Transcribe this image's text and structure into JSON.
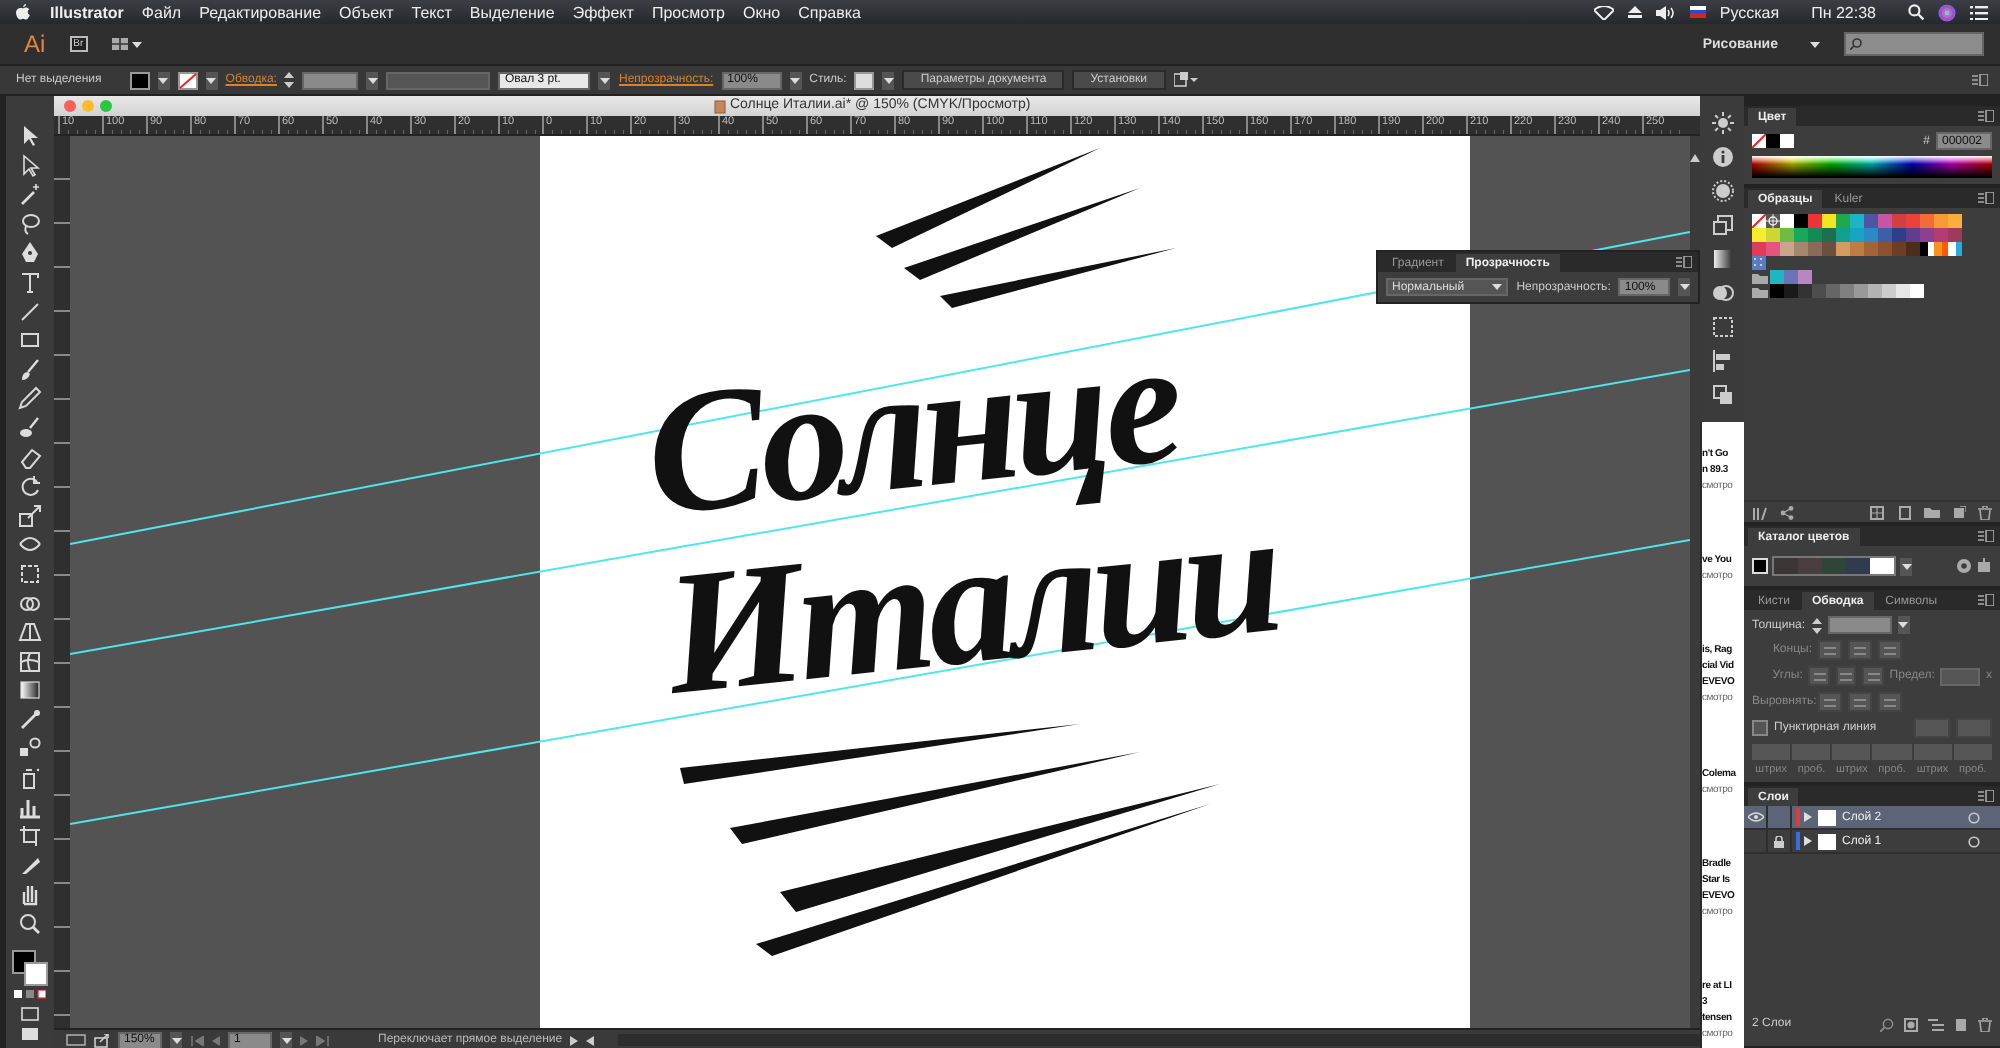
{
  "menu_bar": {
    "app": "Illustrator",
    "items": [
      "Файл",
      "Редактирование",
      "Объект",
      "Текст",
      "Выделение",
      "Эффект",
      "Просмотр",
      "Окно",
      "Справка"
    ],
    "input_source": "Русская",
    "clock": "Пн 22:38"
  },
  "app_bar": {
    "logo": "Ai",
    "bridge": "Br",
    "workspace": "Рисование"
  },
  "control_bar": {
    "selection": "Нет выделения",
    "stroke_label": "Обводка:",
    "brush": "Овал 3 pt.",
    "opacity_label": "Непрозрачность:",
    "opacity": "100%",
    "style_label": "Стиль:",
    "buttons": [
      "Параметры документа",
      "Установки"
    ]
  },
  "document": {
    "title": "Солнце Италии.ai* @ 150% (CMYK/Просмотр)",
    "ruler": [
      "10",
      "100",
      "90",
      "80",
      "70",
      "60",
      "50",
      "40",
      "30",
      "20",
      "10",
      "0",
      "10",
      "20",
      "30",
      "40",
      "50",
      "60",
      "70",
      "80",
      "90",
      "100",
      "110",
      "120",
      "130",
      "140",
      "150",
      "160",
      "170",
      "180",
      "190",
      "200",
      "210",
      "220",
      "230",
      "240",
      "250"
    ],
    "lettering": [
      "Солнце",
      "Италии"
    ]
  },
  "transparency_panel": {
    "tabs": [
      {
        "label": "Градиент",
        "selected": false
      },
      {
        "label": "Прозрачность",
        "selected": true
      }
    ],
    "blend_mode": "Нормальный",
    "opacity_label": "Непрозрачность:",
    "opacity": "100%"
  },
  "status_bar": {
    "zoom": "150%",
    "artboard": "1",
    "message": "Переключает прямое выделение"
  },
  "background_window": {
    "blocks": [
      [
        "n't Go",
        "n 89.3",
        "смотро"
      ],
      [
        "ve You",
        "смотро"
      ],
      [
        "is, Rag",
        "cial Vid",
        "EVEVO",
        "смотро"
      ],
      [
        "Colema",
        "смотро"
      ],
      [
        "Bradle",
        "Star Is",
        "EVEVO",
        "смотро"
      ],
      [
        "re at LI",
        "3",
        "tensen",
        "смотро"
      ]
    ]
  },
  "color_panel": {
    "title": "Цвет",
    "hex_label": "#",
    "hex": "000002"
  },
  "swatches_panel": {
    "tabs": [
      {
        "label": "Образцы",
        "selected": true
      },
      {
        "label": "Kuler",
        "selected": false
      }
    ],
    "rows": [
      {
        "folder": false,
        "swatches": [
          {
            "kind": "none"
          },
          {
            "kind": "registration"
          },
          {
            "kind": "color",
            "color": "#ffffff"
          },
          {
            "kind": "color",
            "color": "#000000"
          },
          {
            "kind": "color",
            "color": "#ee3338"
          },
          {
            "kind": "color",
            "color": "#f4e426"
          },
          {
            "kind": "color",
            "color": "#1fa84f"
          },
          {
            "kind": "color",
            "color": "#1cb5c8"
          },
          {
            "kind": "color",
            "color": "#4e55a5"
          },
          {
            "kind": "color",
            "color": "#c855a3"
          },
          {
            "kind": "color",
            "color": "#d33f3f"
          },
          {
            "kind": "color",
            "color": "#e8433b"
          },
          {
            "kind": "color",
            "color": "#f26b3a"
          },
          {
            "kind": "color",
            "color": "#f79a33"
          },
          {
            "kind": "color",
            "color": "#fbad3e"
          }
        ]
      },
      {
        "folder": false,
        "swatches": [
          {
            "kind": "color",
            "color": "#f7ec2d"
          },
          {
            "kind": "color",
            "color": "#cdd733"
          },
          {
            "kind": "color",
            "color": "#6dbd45"
          },
          {
            "kind": "color",
            "color": "#18a85a"
          },
          {
            "kind": "color",
            "color": "#138b54"
          },
          {
            "kind": "color",
            "color": "#1d6e53"
          },
          {
            "kind": "color",
            "color": "#139f8e"
          },
          {
            "kind": "color",
            "color": "#17a4c1"
          },
          {
            "kind": "color",
            "color": "#2b8ac5"
          },
          {
            "kind": "color",
            "color": "#3d5ea9"
          },
          {
            "kind": "color",
            "color": "#2d3e8a"
          },
          {
            "kind": "color",
            "color": "#613d8f"
          },
          {
            "kind": "color",
            "color": "#8d3f90"
          },
          {
            "kind": "color",
            "color": "#b33b76"
          },
          {
            "kind": "color",
            "color": "#9e3a5c"
          }
        ]
      },
      {
        "folder": false,
        "swatches": [
          {
            "kind": "color",
            "color": "#e13b5c"
          },
          {
            "kind": "color",
            "color": "#e2557f"
          },
          {
            "kind": "color",
            "color": "#c9a58a"
          },
          {
            "kind": "color",
            "color": "#a8866d"
          },
          {
            "kind": "color",
            "color": "#8a6a58"
          },
          {
            "kind": "color",
            "color": "#6b4f3f"
          },
          {
            "kind": "color",
            "color": "#d39a64"
          },
          {
            "kind": "color",
            "color": "#c17c43"
          },
          {
            "kind": "color",
            "color": "#a3643a"
          },
          {
            "kind": "color",
            "color": "#8a5231"
          },
          {
            "kind": "color",
            "color": "#6a3e27"
          },
          {
            "kind": "color",
            "color": "#4c2c1c"
          },
          {
            "kind": "gradient",
            "stops": [
              {
                "color": "#000000"
              },
              {
                "color": "#ffffff"
              }
            ]
          },
          {
            "kind": "gradient",
            "stops": [
              {
                "color": "#f7931e"
              },
              {
                "color": "#ff5a00"
              }
            ]
          },
          {
            "kind": "gradient",
            "stops": [
              {
                "color": "#ffffff"
              },
              {
                "color": "#29abe2"
              }
            ]
          }
        ]
      },
      {
        "folder": false,
        "swatches": [
          {
            "kind": "pattern",
            "color": "#5a7dbf"
          }
        ]
      },
      {
        "folder": true,
        "swatches": [
          {
            "kind": "color",
            "color": "#1fb5c3"
          },
          {
            "kind": "color",
            "color": "#6a74b5"
          },
          {
            "kind": "color",
            "color": "#b887c2"
          }
        ]
      },
      {
        "folder": true,
        "swatches": [
          {
            "kind": "color",
            "color": "#000000"
          },
          {
            "kind": "color",
            "color": "#1a1a1a"
          },
          {
            "kind": "color",
            "color": "#333333"
          },
          {
            "kind": "color",
            "color": "#4d4d4d"
          },
          {
            "kind": "color",
            "color": "#666666"
          },
          {
            "kind": "color",
            "color": "#808080"
          },
          {
            "kind": "color",
            "color": "#999999"
          },
          {
            "kind": "color",
            "color": "#b3b3b3"
          },
          {
            "kind": "color",
            "color": "#cccccc"
          },
          {
            "kind": "color",
            "color": "#e6e6e6"
          },
          {
            "kind": "color",
            "color": "#ffffff"
          }
        ]
      }
    ]
  },
  "color_guide_panel": {
    "title": "Каталог цветов",
    "colors": [
      {
        "color": "#3b3535"
      },
      {
        "color": "#4a3d3d"
      },
      {
        "color": "#2f4538"
      },
      {
        "color": "#313a4e"
      },
      {
        "color": "#ffffff"
      }
    ]
  },
  "stroke_panel": {
    "tabs": [
      {
        "label": "Кисти",
        "selected": false
      },
      {
        "label": "Обводка",
        "selected": true
      },
      {
        "label": "Символы",
        "selected": false
      }
    ],
    "weight_label": "Толщина:",
    "cap_label": "Концы:",
    "corner_label": "Углы:",
    "limit_label": "Предел:",
    "limit_unit": "x",
    "align_label": "Выровнять:",
    "dashed_label": "Пунктирная линия",
    "dashed_line": false,
    "dash_fields": [
      "штрих",
      "проб.",
      "штрих",
      "проб.",
      "штрих",
      "проб."
    ]
  },
  "layers_panel": {
    "title": "Слои",
    "layers": [
      {
        "name": "Слой 2",
        "color": "#e03a3a",
        "selected": true,
        "visible": true,
        "locked": false
      },
      {
        "name": "Слой 1",
        "color": "#3a6ee0",
        "selected": false,
        "visible": false,
        "locked": true
      }
    ],
    "count": "2 Слои"
  }
}
